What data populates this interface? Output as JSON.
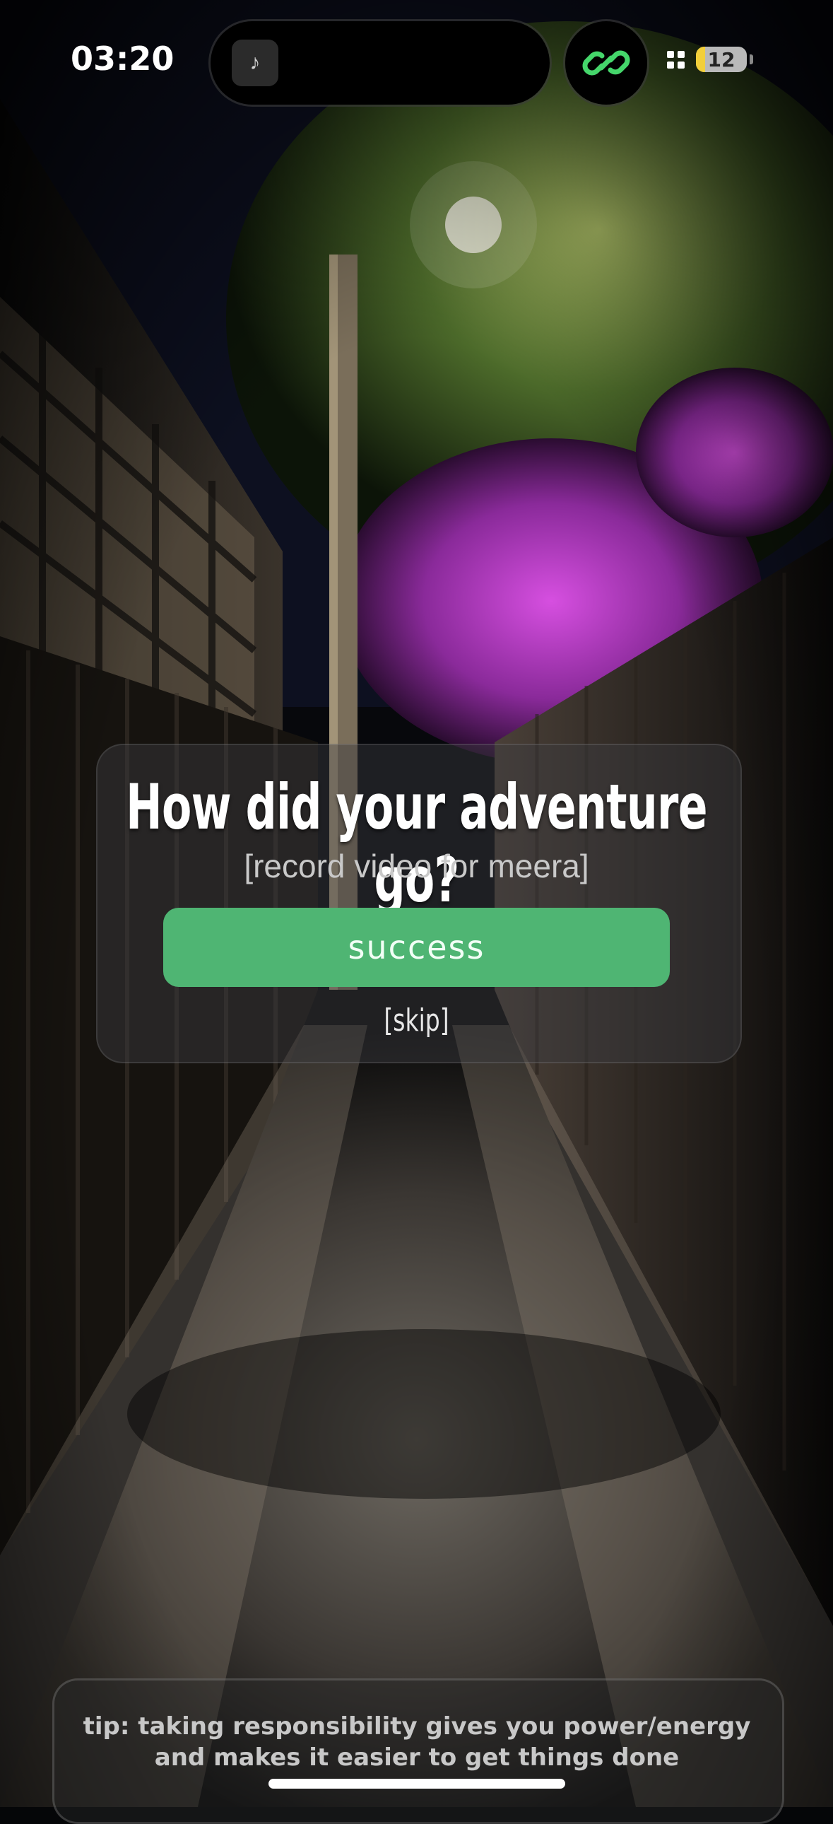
{
  "status_bar": {
    "time": "03:20",
    "battery_level": "12",
    "battery_fraction": 0.12,
    "music_icon": "music-note-icon",
    "link_icon": "link-icon",
    "accent": "#45d66b"
  },
  "prompt": {
    "title": "How did your adventure go?",
    "subtitle": "[record video for meera]",
    "success_label": "success",
    "skip_label": "[skip]",
    "button_color": "#4fb573"
  },
  "tip": {
    "line1": "tip: taking responsibility gives you power/energy",
    "line2": "and makes it easier to get things done"
  }
}
